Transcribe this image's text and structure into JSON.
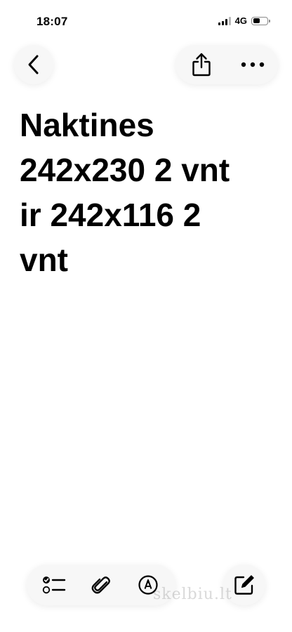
{
  "status_bar": {
    "time": "18:07",
    "network": "4G",
    "signal_bars_active": 3,
    "signal_bars_total": 4,
    "battery_level": 0.55
  },
  "toolbar": {
    "back_icon": "chevron-left-icon",
    "share_icon": "share-icon",
    "more_icon": "more-horizontal-icon"
  },
  "note": {
    "lines": [
      "Naktines",
      "242x230 2 vnt",
      "ir 242x116 2",
      "vnt"
    ]
  },
  "bottom_toolbar": {
    "checklist_icon": "checklist-icon",
    "attachment_icon": "paperclip-icon",
    "markup_icon": "markup-pen-icon",
    "compose_icon": "compose-icon"
  },
  "watermark": {
    "text": "skelbiu.lt"
  }
}
